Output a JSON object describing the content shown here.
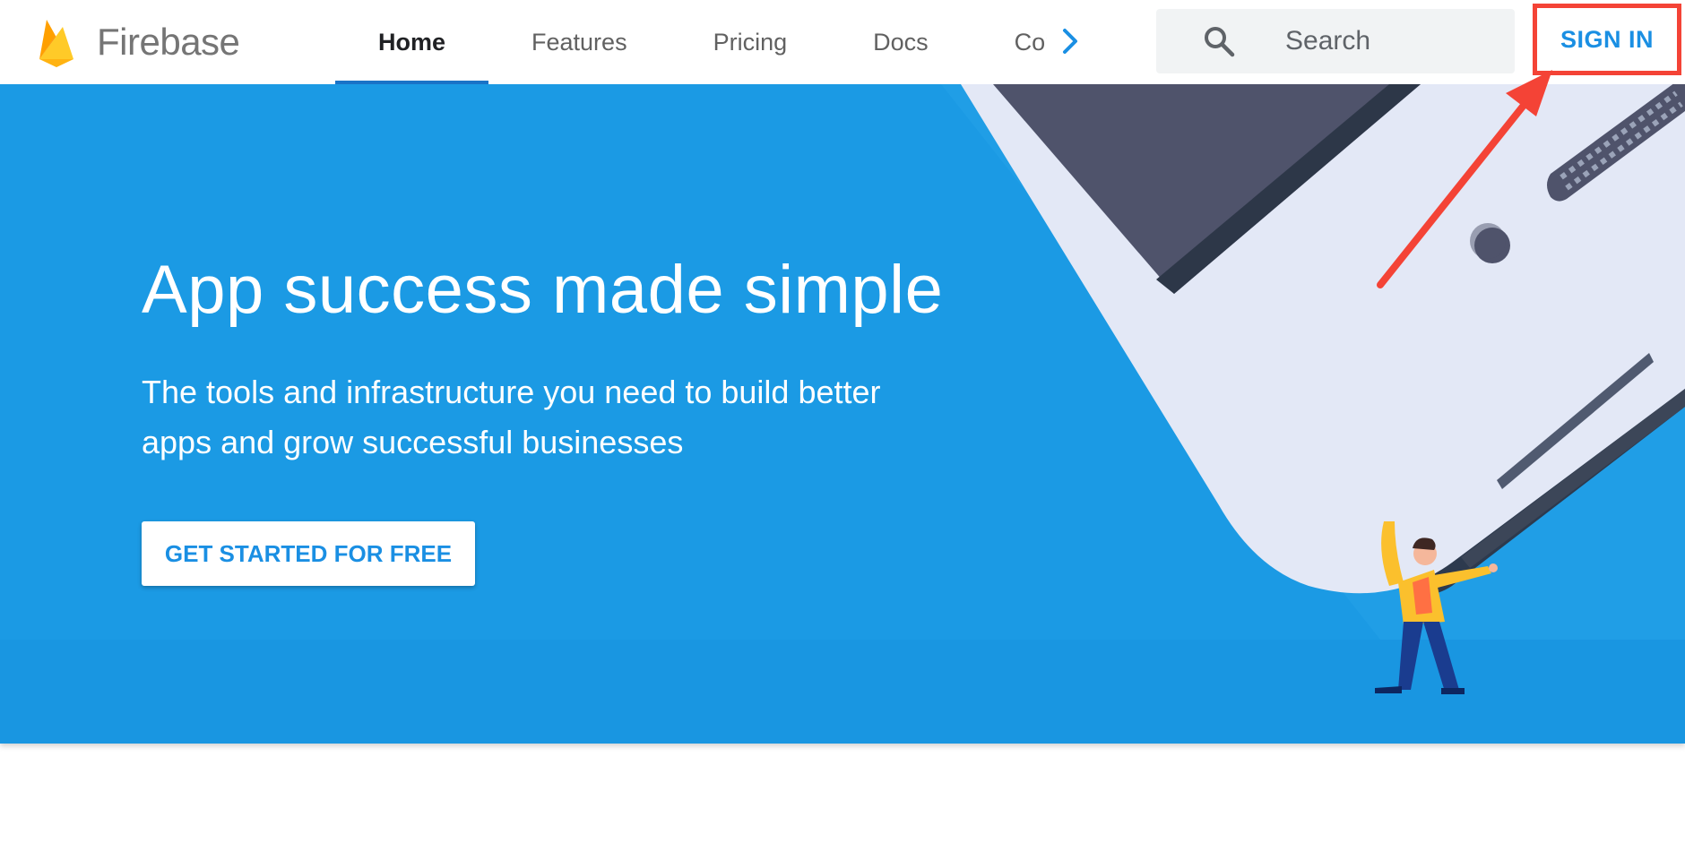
{
  "header": {
    "brand": "Firebase",
    "nav_tabs": [
      {
        "label": "Home",
        "active": true
      },
      {
        "label": "Features",
        "active": false
      },
      {
        "label": "Pricing",
        "active": false
      },
      {
        "label": "Docs",
        "active": false
      },
      {
        "label": "Community",
        "active": false
      }
    ],
    "search_placeholder": "Search",
    "sign_in": "SIGN IN"
  },
  "hero": {
    "title": "App success made simple",
    "subtitle": "The tools and infrastructure you need to build better apps and grow successful businesses",
    "cta": "GET STARTED FOR FREE"
  },
  "icons": [
    "firebase-logo-icon",
    "chevron-right-icon",
    "search-icon"
  ],
  "colors": {
    "hero_bg": "#1b9ae4",
    "accent": "#1a8fe3",
    "active_tab_underline": "#1a73c7",
    "annotation": "#f44336"
  }
}
